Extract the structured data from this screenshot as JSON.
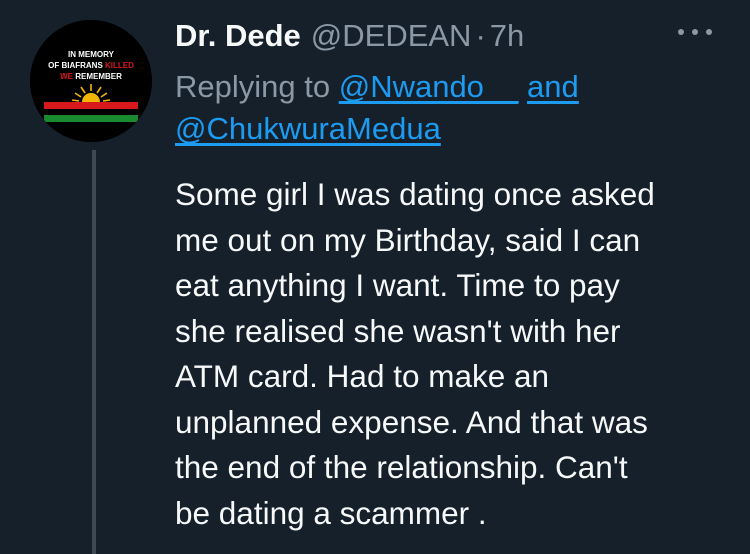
{
  "author": {
    "display_name": "Dr. Dede",
    "handle": "@DEDEAN",
    "separator": "·",
    "time": "7h"
  },
  "avatar": {
    "line1": "IN MEMORY",
    "line2a": "OF BIAFRANS ",
    "line2b": "KILLED",
    "line3a": "WE",
    "line3b": " REMEMBER",
    "colors": {
      "background": "#000000",
      "red": "#d7191c",
      "green": "#1a8a2e",
      "sun": "#f2b705"
    }
  },
  "reply": {
    "prefix": "Replying to ",
    "mention1": "@Nwando__",
    "conjunction": "and",
    "mention2": "@ChukwuraMedua"
  },
  "tweet": {
    "text": "Some girl I was dating once asked\nme out on my Birthday,  said I can\neat anything I want. Time to pay\nshe  realised she wasn't with her\nATM card. Had to make an\nunplanned expense. And that was\nthe end of the relationship.  Can't\nbe dating a scammer ."
  },
  "icons": {
    "more": "more-horizontal-icon"
  },
  "colors": {
    "background": "#15202b",
    "text_primary": "#f7f9f9",
    "text_secondary": "#8b98a5",
    "link": "#1d9bf0"
  }
}
